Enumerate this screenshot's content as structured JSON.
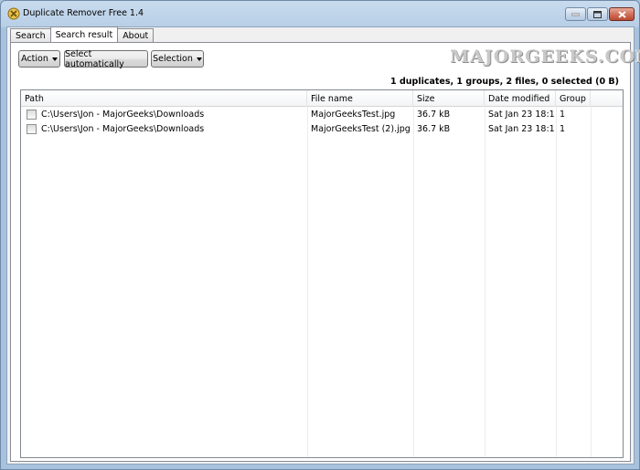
{
  "window": {
    "title": "Duplicate Remover Free 1.4",
    "icon": "app-icon"
  },
  "tabs": [
    {
      "label": "Search",
      "active": false
    },
    {
      "label": "Search result",
      "active": true
    },
    {
      "label": "About",
      "active": false
    }
  ],
  "toolbar": {
    "action_label": "Action",
    "select_auto_label": "Select automatically",
    "selection_label": "Selection"
  },
  "watermark": "MAJORGEEKS.COM",
  "summary": "1 duplicates, 1 groups, 2 files, 0 selected (0 B)",
  "columns": [
    "Path",
    "File name",
    "Size",
    "Date modified",
    "Group"
  ],
  "rows": [
    {
      "checked": false,
      "path": "C:\\Users\\Jon - MajorGeeks\\Downloads",
      "file": "MajorGeeksTest.jpg",
      "size": "36.7 kB",
      "date": "Sat Jan 23 18:1...",
      "group": "1"
    },
    {
      "checked": false,
      "path": "C:\\Users\\Jon - MajorGeeks\\Downloads",
      "file": "MajorGeeksTest (2).jpg",
      "size": "36.7 kB",
      "date": "Sat Jan 23 18:1...",
      "group": "1"
    }
  ],
  "colors": {
    "titlebar": "#b8cfe6",
    "close_button": "#cf6c57"
  }
}
